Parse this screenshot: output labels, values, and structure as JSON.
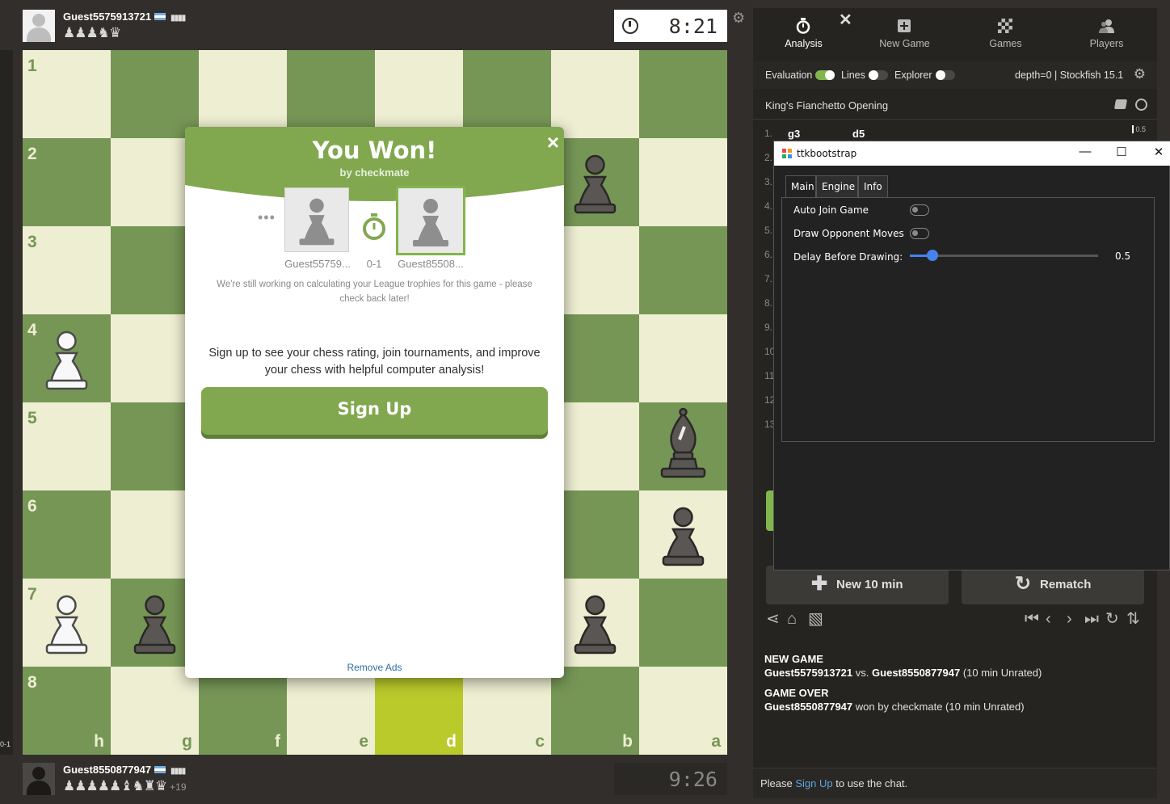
{
  "colors": {
    "board_light": "#eeeed2",
    "board_dark": "#769656",
    "highlight": "#baca2b",
    "accent_green": "#81b64c",
    "link_blue": "#2c6fa6"
  },
  "left_strip": {
    "score": "0-1"
  },
  "top_player": {
    "name": "Guest5575913721",
    "captured": "♟♟♟♞♛",
    "clock": "8:21"
  },
  "bottom_player": {
    "name": "Guest8550877947",
    "captured": "♟♟♟♟♟♝♞♜♛",
    "captured_extra": "+19",
    "clock": "9:26"
  },
  "board": {
    "orientation": "black",
    "ranks_top_to_bottom": [
      "1",
      "2",
      "3",
      "4",
      "5",
      "6",
      "7",
      "8"
    ],
    "files_left_to_right": [
      "h",
      "g",
      "f",
      "e",
      "d",
      "c",
      "b",
      "a"
    ],
    "highlighted": [
      [
        7,
        4
      ]
    ],
    "pieces": [
      {
        "row": 1,
        "col": 6,
        "type": "pawn",
        "color": "black"
      },
      {
        "row": 3,
        "col": 0,
        "type": "pawn",
        "color": "white"
      },
      {
        "row": 4,
        "col": 7,
        "type": "bishop",
        "color": "black"
      },
      {
        "row": 5,
        "col": 7,
        "type": "pawn",
        "color": "black"
      },
      {
        "row": 6,
        "col": 0,
        "type": "pawn",
        "color": "white"
      },
      {
        "row": 6,
        "col": 1,
        "type": "pawn",
        "color": "black"
      },
      {
        "row": 6,
        "col": 6,
        "type": "pawn",
        "color": "black"
      }
    ]
  },
  "modal": {
    "title": "You Won!",
    "subtitle": "by checkmate",
    "close": "×",
    "ellipsis": "•••",
    "left_player": "Guest55759...",
    "right_player": "Guest85508...",
    "score": "0-1",
    "trophy_note": "We're still working on calculating your League trophies for this game - please check back later!",
    "signup_text": "Sign up to see your chess rating, join tournaments, and improve your chess with helpful computer analysis!",
    "signup_button": "Sign Up",
    "remove_ads": "Remove Ads"
  },
  "panel": {
    "tabs": [
      {
        "label": "Analysis",
        "icon": "stopwatch-icon"
      },
      {
        "label": "New Game",
        "icon": "plus-board-icon"
      },
      {
        "label": "Games",
        "icon": "chessboard-icon"
      },
      {
        "label": "Players",
        "icon": "players-icon"
      }
    ],
    "close": "✕",
    "settings": {
      "evaluation_label": "Evaluation",
      "evaluation_on": true,
      "lines_label": "Lines",
      "lines_on": false,
      "explorer_label": "Explorer",
      "explorer_on": false,
      "engine_info": "depth=0  |  Stockfish 15.1"
    },
    "opening": "King's Fianchetto Opening",
    "moves": [
      {
        "num": "1.",
        "white": "g3",
        "black": "d5"
      },
      {
        "num": "2."
      },
      {
        "num": "3."
      },
      {
        "num": "4."
      },
      {
        "num": "5."
      },
      {
        "num": "6."
      },
      {
        "num": "7."
      },
      {
        "num": "8."
      },
      {
        "num": "9."
      },
      {
        "num": "10"
      },
      {
        "num": "11"
      },
      {
        "num": "12"
      },
      {
        "num": "13"
      }
    ],
    "eval_marker": "0.5",
    "new_game_button": "New 10 min",
    "rematch_button": "Rematch",
    "log": {
      "new_game_header": "NEW GAME",
      "new_game_white": "Guest5575913721",
      "new_game_vs": "vs.",
      "new_game_black": "Guest8550877947",
      "new_game_type": "(10 min Unrated)",
      "game_over_header": "GAME OVER",
      "game_over_winner": "Guest8550877947",
      "game_over_text": "won by checkmate (10 min Unrated)"
    },
    "chat": {
      "prefix": "Please",
      "link": "Sign Up",
      "suffix": "to use the chat."
    }
  },
  "tk_window": {
    "title": "ttkbootstrap",
    "tabs": [
      "Main",
      "Engine",
      "Info"
    ],
    "active_tab": "Main",
    "auto_join_label": "Auto Join Game",
    "auto_join_on": false,
    "draw_moves_label": "Draw Opponent Moves",
    "draw_moves_on": false,
    "delay_label": "Delay Before Drawing:",
    "delay_value": "0.5",
    "delay_fraction": 0.12
  }
}
